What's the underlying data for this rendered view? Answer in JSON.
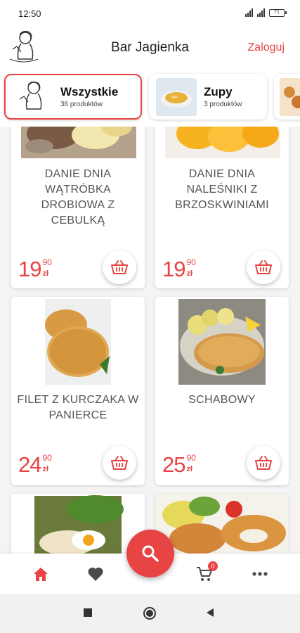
{
  "status": {
    "time": "12:50",
    "battery": "71"
  },
  "header": {
    "title": "Bar Jagienka",
    "login_label": "Zaloguj"
  },
  "categories": [
    {
      "name": "Wszystkie",
      "count": "36 produktów",
      "active": true
    },
    {
      "name": "Zupy",
      "count": "3 produktów",
      "active": false
    }
  ],
  "products": [
    {
      "name": "DANIE DNIA WĄTRÓBKA DROBIOWA Z CEBULKĄ",
      "price_main": "19",
      "price_cents": "90",
      "currency": "zł"
    },
    {
      "name": "DANIE  DNIA NALEŚNIKI Z BRZOSKWINIAMI",
      "price_main": "19",
      "price_cents": "90",
      "currency": "zł"
    },
    {
      "name": "FILET Z KURCZAKA W PANIERCE",
      "price_main": "24",
      "price_cents": "90",
      "currency": "zł"
    },
    {
      "name": "SCHABOWY",
      "price_main": "25",
      "price_cents": "90",
      "currency": "zł"
    }
  ],
  "bottom_nav": {
    "items": [
      "home-icon",
      "heart-icon",
      "cart-icon",
      "more-icon"
    ],
    "cart_badge": "0"
  },
  "colors": {
    "accent": "#e84443",
    "text": "#555555",
    "background": "#f4f4f4"
  }
}
